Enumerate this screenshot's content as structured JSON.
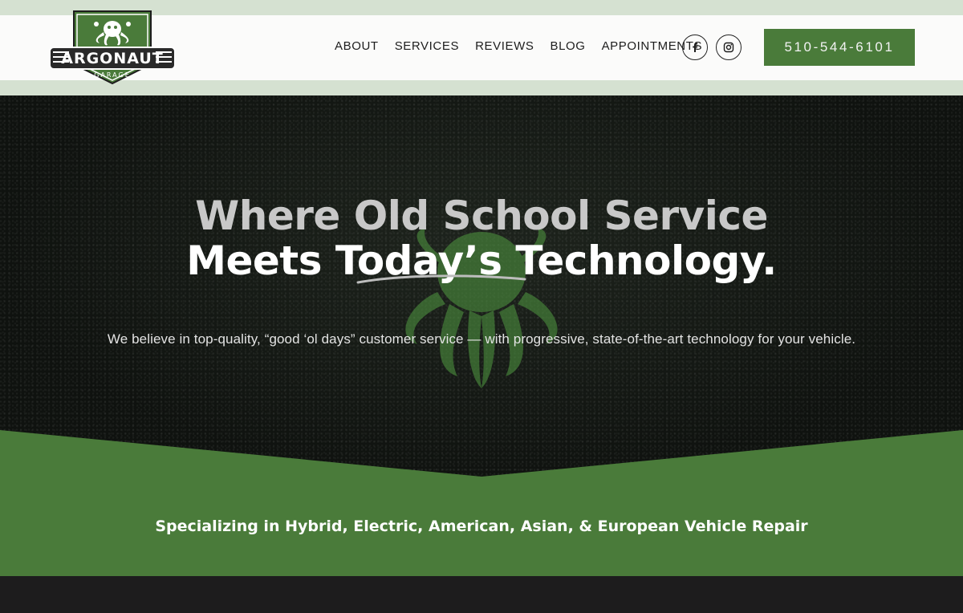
{
  "brand": {
    "name": "ARGONAUT",
    "sub": "GARAGE",
    "colors": {
      "green": "#4a7b3a",
      "light_green": "#d5e1d1",
      "dark": "#1d1c1d"
    }
  },
  "nav": {
    "items": [
      {
        "label": "ABOUT"
      },
      {
        "label": "SERVICES"
      },
      {
        "label": "REVIEWS"
      },
      {
        "label": "BLOG"
      },
      {
        "label": "APPOINTMENTS"
      }
    ]
  },
  "social": {
    "facebook_icon": "facebook-icon",
    "instagram_icon": "instagram-icon"
  },
  "phone": {
    "label": "510-544-6101"
  },
  "hero": {
    "headline_line1": "Where Old School Service",
    "headline_line2": "Meets Today’s Technology.",
    "subline": "We believe in top-quality, “good ‘ol days” customer service — with progressive, state-of-the-art technology for your vehicle."
  },
  "specialty": {
    "text": "Specializing in Hybrid, Electric, American, Asian, & European Vehicle Repair"
  }
}
